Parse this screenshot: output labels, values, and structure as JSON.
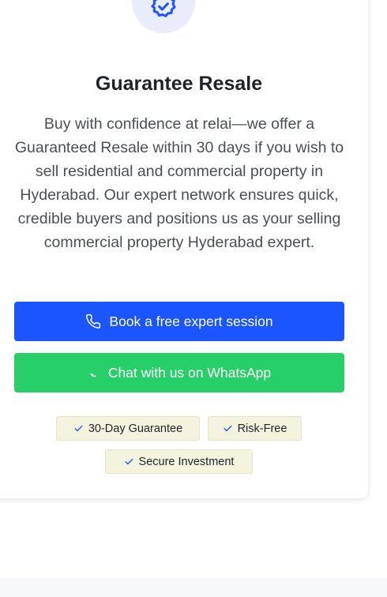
{
  "section": {
    "title": "Guarantee Resale",
    "description": "Buy with confidence at relai—we offer a Guaranteed Resale within 30 days if you wish to sell residential and commercial property in Hyderabad. Our expert network ensures quick, credible buyers and positions us as your selling commercial property Hyderabad expert.",
    "icon": "verified-badge-icon"
  },
  "buttons": {
    "book_label": "Book a free expert session",
    "whatsapp_label": "Chat with us on WhatsApp"
  },
  "tags": [
    "30-Day Guarantee",
    "Risk-Free",
    "Secure Investment"
  ],
  "colors": {
    "primary": "#1a55ff",
    "whatsapp": "#27cf68",
    "tag_bg": "#f4f3dd",
    "icon_circle": "#e8ecfb"
  }
}
